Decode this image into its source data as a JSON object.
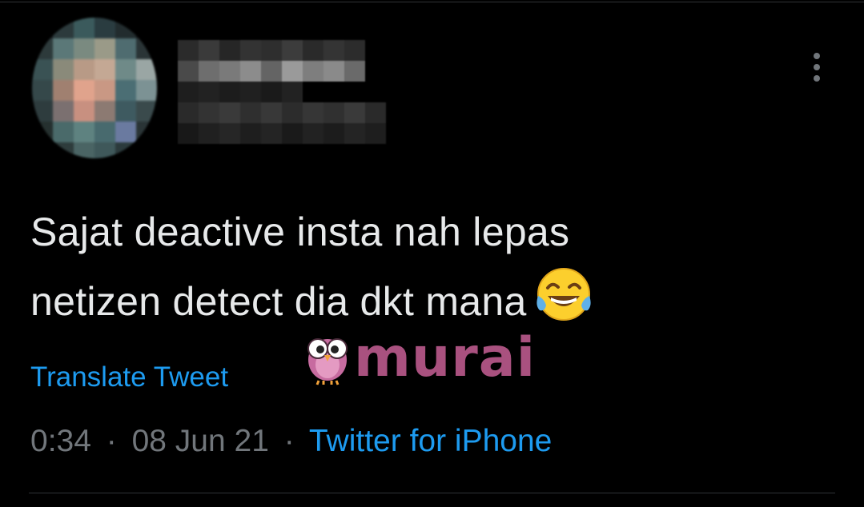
{
  "tweet": {
    "line1": "Sajat deactive insta nah lepas",
    "line2": "netizen detect dia dkt mana",
    "emoji": "face-with-tears-of-joy-emoji",
    "translate_label": "Translate Tweet",
    "time": "0:34",
    "separator": "·",
    "date": "08 Jun 21",
    "source": "Twitter for iPhone"
  },
  "watermark": {
    "text": "murai"
  },
  "icons": {
    "more": "more-vertical-icon",
    "mascot": "owl-mascot-icon"
  },
  "colors": {
    "background": "#000000",
    "text": "#e7e9ea",
    "muted": "#71767b",
    "link": "#1d9bf0",
    "watermark": "#a9517f"
  }
}
